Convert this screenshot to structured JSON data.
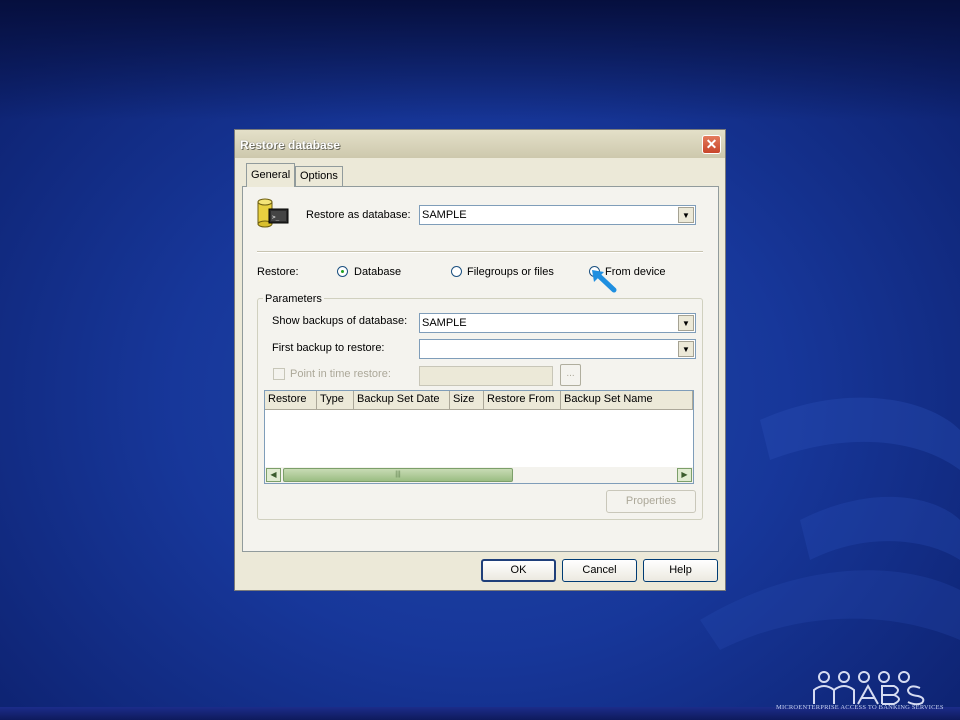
{
  "dialog": {
    "title": "Restore database",
    "close_glyph": "✕"
  },
  "tabs": [
    {
      "label": "General",
      "active": true
    },
    {
      "label": "Options",
      "active": false
    }
  ],
  "general": {
    "restore_as_label": "Restore as database:",
    "restore_as_value": "SAMPLE",
    "restore_label": "Restore:",
    "radios": [
      {
        "label": "Database",
        "checked": true
      },
      {
        "label": "Filegroups or files",
        "checked": false
      },
      {
        "label": "From device",
        "checked": false
      }
    ]
  },
  "parameters": {
    "legend": "Parameters",
    "show_backups_label": "Show backups of database:",
    "show_backups_value": "SAMPLE",
    "first_backup_label": "First backup to restore:",
    "first_backup_value": "",
    "point_in_time_label": "Point in time restore:",
    "browse_label": "...",
    "columns": [
      "Restore",
      "Type",
      "Backup Set Date",
      "Size",
      "Restore From",
      "Backup Set Name"
    ],
    "rows": [],
    "scroll_thumb_grip": "|||",
    "properties_label": "Properties"
  },
  "buttons": {
    "ok": "OK",
    "cancel": "Cancel",
    "help": "Help"
  },
  "icons": {
    "database": "database-icon",
    "close": "close-icon",
    "dropdown": "chevron-down-icon",
    "scroll_left": "arrow-left-icon",
    "scroll_right": "arrow-right-icon",
    "pointer": "arrow-pointer-icon"
  },
  "branding": {
    "footer_text": "MICROENTERPRISE ACCESS TO BANKING SERVICES"
  },
  "colors": {
    "background": "#17379a",
    "dialog_face": "#ece9d8",
    "close_button": "#c8452a",
    "pointer": "#1f8fe0"
  }
}
